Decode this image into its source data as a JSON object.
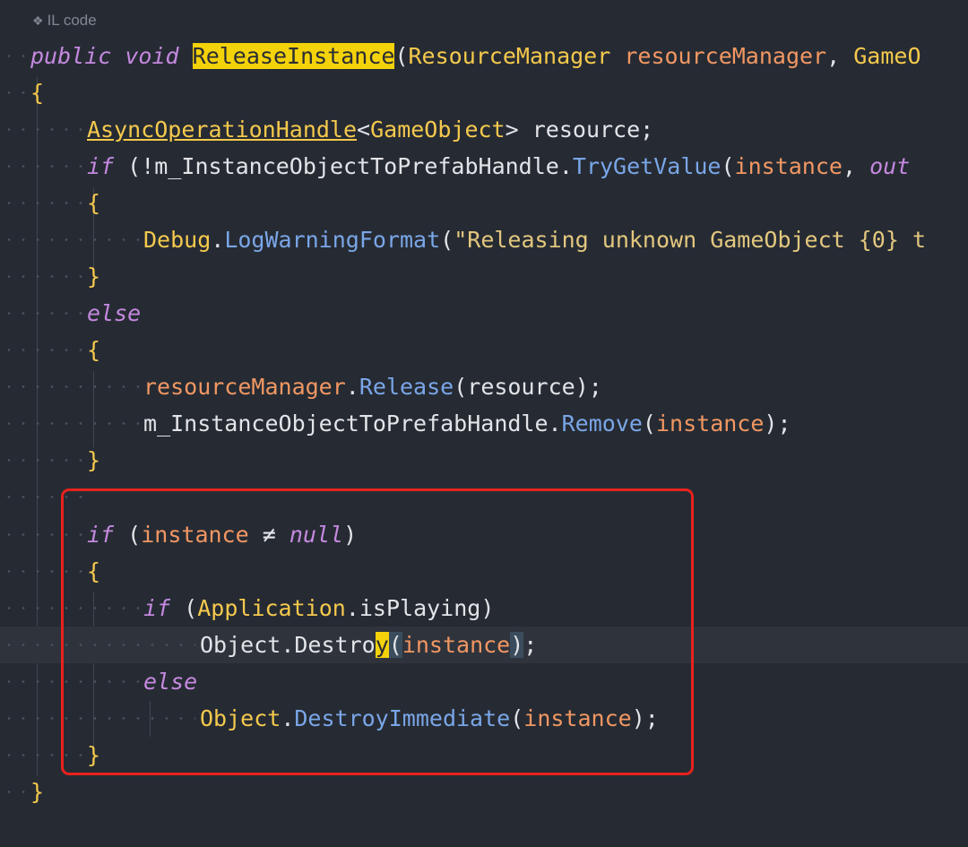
{
  "header": {
    "icon": "diamond-icon",
    "label": "IL code"
  },
  "colors": {
    "background": "#262b33",
    "keyword": "#c589e0",
    "type": "#f5c94d",
    "method": "#7aa6e8",
    "parameter": "#f29763",
    "highlight": "#f4d20a",
    "annotation_box": "#e8221d"
  },
  "code": {
    "l1": {
      "kw1": "public",
      "kw2": "void",
      "name": "ReleaseInstance",
      "open": "(",
      "type1": "ResourceManager",
      "param1": "resourceManager",
      "comma": ",",
      "type2": "GameO"
    },
    "l2": {
      "brace": "{"
    },
    "l3": {
      "type": "AsyncOperationHandle",
      "lt": "<",
      "type2": "GameObject",
      "gt": ">",
      "var": "resource",
      "semi": ";"
    },
    "l4": {
      "kw": "if",
      "open": "(",
      "neg": "!",
      "field": "m_InstanceObjectToPrefabHandle",
      "dot": ".",
      "method": "TryGetValue",
      "open2": "(",
      "arg": "instance",
      "comma": ",",
      "kw2": "out"
    },
    "l5": {
      "brace": "{"
    },
    "l6": {
      "type": "Debug",
      "dot": ".",
      "method": "LogWarningFormat",
      "open": "(",
      "str": "\"Releasing unknown GameObject {0} t"
    },
    "l7": {
      "brace": "}"
    },
    "l8": {
      "kw": "else"
    },
    "l9": {
      "brace": "{"
    },
    "l10": {
      "param": "resourceManager",
      "dot": ".",
      "method": "Release",
      "open": "(",
      "arg": "resource",
      "close": ");"
    },
    "l11": {
      "field": "m_InstanceObjectToPrefabHandle",
      "dot": ".",
      "method": "Remove",
      "open": "(",
      "arg": "instance",
      "close": ");"
    },
    "l12": {
      "brace": "}"
    },
    "l13": {
      "kw": "if",
      "open": "(",
      "arg": "instance",
      "op": "≠",
      "kw2": "null",
      "close": ")"
    },
    "l14": {
      "brace": "{"
    },
    "l15": {
      "kw": "if",
      "open": "(",
      "type": "Application",
      "dot": ".",
      "prop": "isPlaying",
      "close": ")"
    },
    "l16": {
      "type": "Object",
      "dot": ".",
      "method_a": "Destro",
      "method_b": "y",
      "open": "(",
      "arg": "instance",
      "close": ")",
      "semi": ";"
    },
    "l17": {
      "kw": "else"
    },
    "l18": {
      "type": "Object",
      "dot": ".",
      "method": "DestroyImmediate",
      "open": "(",
      "arg": "instance",
      "close": ");"
    },
    "l19": {
      "brace": "}"
    },
    "l20": {
      "brace": "}"
    }
  }
}
